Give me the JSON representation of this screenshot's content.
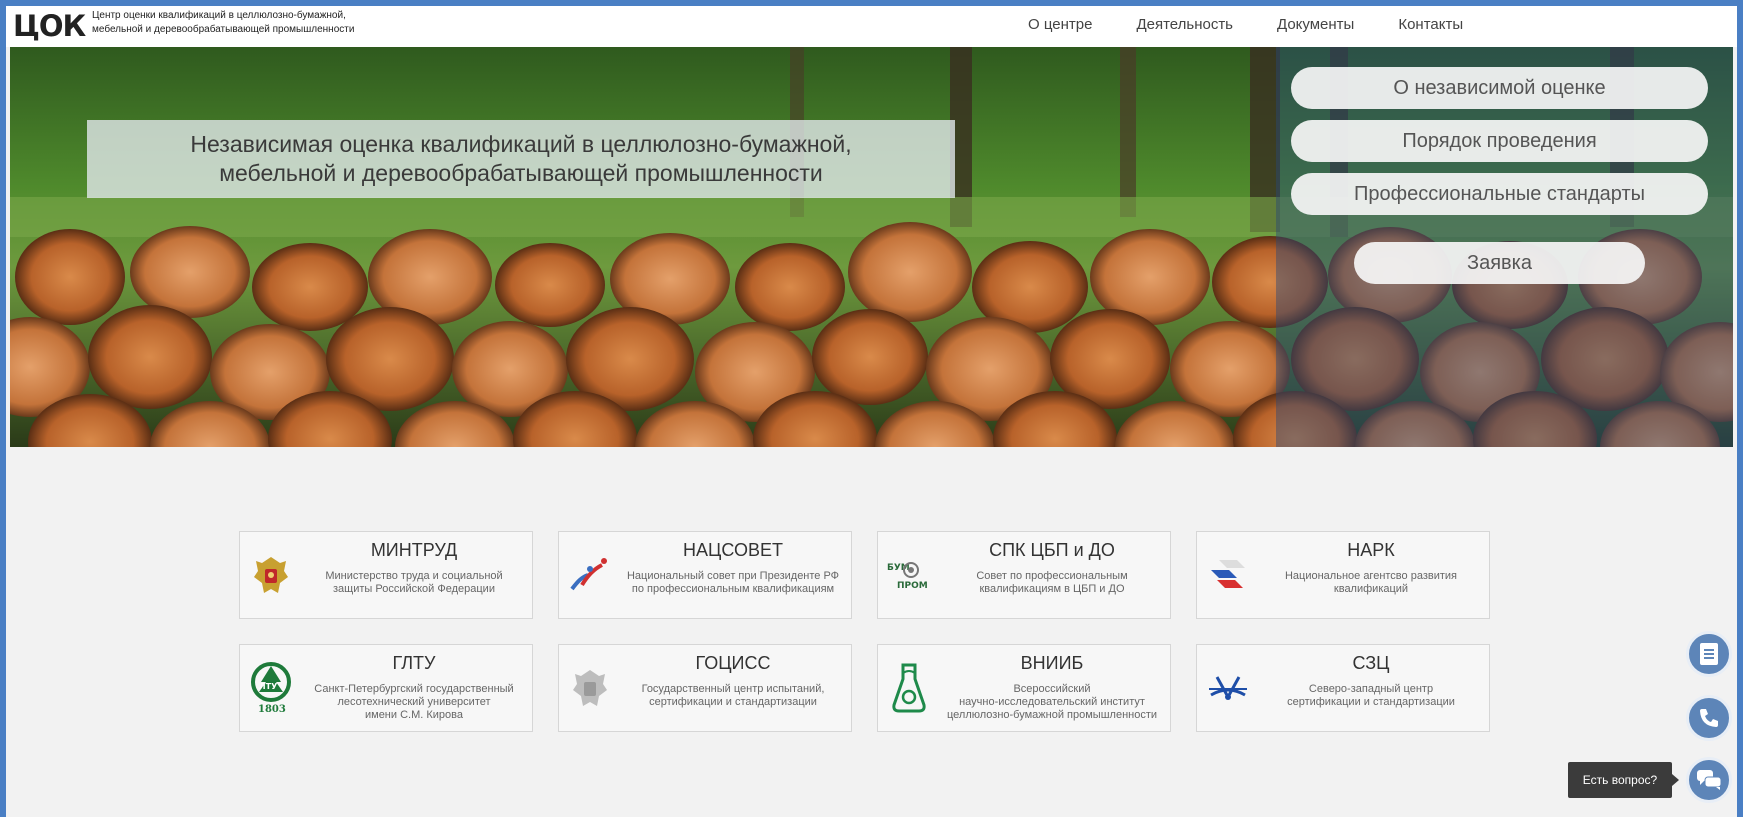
{
  "header": {
    "logo": "ЦОК",
    "logo_subtitle": "Центр оценки квалификаций в целлюлозно-бумажной, мебельной и деревообрабатывающей промышленности",
    "nav": [
      {
        "label": "О центре"
      },
      {
        "label": "Деятельность"
      },
      {
        "label": "Документы"
      },
      {
        "label": "Контакты"
      }
    ]
  },
  "hero": {
    "title": "Независимая оценка квалификаций в целлюлозно-бумажной,\nмебельной и деревообрабатывающей промышленности",
    "buttons": [
      {
        "label": "О независимой оценке"
      },
      {
        "label": "Порядок проведения"
      },
      {
        "label": "Профессиональные стандарты"
      },
      {
        "label": "Заявка"
      }
    ]
  },
  "organizations": [
    {
      "name": "МИНТРУД",
      "desc": "Министерство труда и социальной\nзащиты Российской Федерации",
      "icon": "coat-of-arms-icon"
    },
    {
      "name": "НАЦСОВЕТ",
      "desc": "Национальный совет при Президенте РФ\nпо профессиональным квалификациям",
      "icon": "natssovet-logo-icon"
    },
    {
      "name": "СПК ЦБП и ДО",
      "desc": "Совет по профессиональным\nквалификациям в ЦБП и ДО",
      "icon": "spk-logo-icon"
    },
    {
      "name": "НАРК",
      "desc": "Национальное агентсво развития\nквалификаций",
      "icon": "nark-logo-icon"
    },
    {
      "name": "ГЛТУ",
      "desc": "Санкт-Петербургский государственный\nлесотехнический университет\nимени С.М. Кирова",
      "icon": "gltu-logo-icon",
      "logo_year": "1803"
    },
    {
      "name": "ГОЦИСС",
      "desc": "Государственный центр испытаний,\nсертификации и стандартизации",
      "icon": "gotsiss-emblem-icon"
    },
    {
      "name": "ВНИИБ",
      "desc": "Всероссийский\nнаучно-исследовательский институт\nцеллюлозно-бумажной промышленности",
      "icon": "vniib-flask-icon"
    },
    {
      "name": "СЗЦ",
      "desc": "Северо-западный центр\nсертификации и стандартизации",
      "icon": "szc-logo-icon"
    }
  ],
  "floating": {
    "tooltip": "Есть вопрос?",
    "buttons": [
      {
        "icon": "document-icon"
      },
      {
        "icon": "phone-icon"
      },
      {
        "icon": "chat-icon"
      }
    ]
  },
  "colors": {
    "frame": "#4a7fc4",
    "float_button": "#5d85b8",
    "page_bg": "#f2f2f2"
  }
}
